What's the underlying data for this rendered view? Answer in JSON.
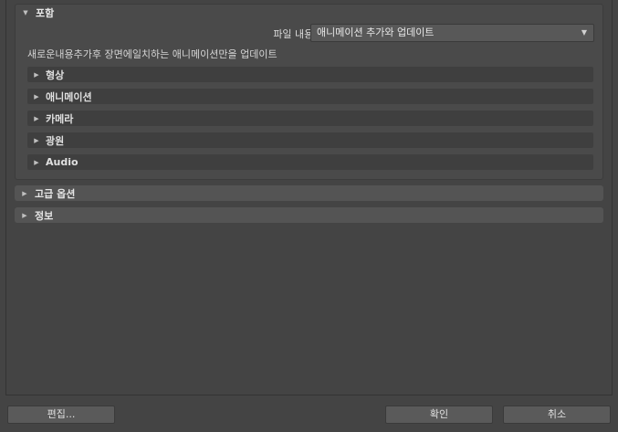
{
  "include": {
    "title": "포함",
    "file_content_label": "파일 내용:",
    "file_content_value": "애니메이션 추가와 업데이트",
    "description": "새로운내용추가후 장면에일치하는 애니메이션만을 업데이트",
    "subsections": [
      {
        "label": "형상"
      },
      {
        "label": "애니메이션"
      },
      {
        "label": "카메라"
      },
      {
        "label": "광원"
      },
      {
        "label": "Audio"
      }
    ]
  },
  "advanced_options": {
    "title": "고급 옵션"
  },
  "info": {
    "title": "정보"
  },
  "buttons": {
    "edit": "편집...",
    "ok": "확인",
    "cancel": "취소"
  },
  "icons": {
    "expanded": "triangle-down-icon",
    "collapsed": "triangle-right-icon",
    "dropdown": "chevron-down-icon"
  }
}
